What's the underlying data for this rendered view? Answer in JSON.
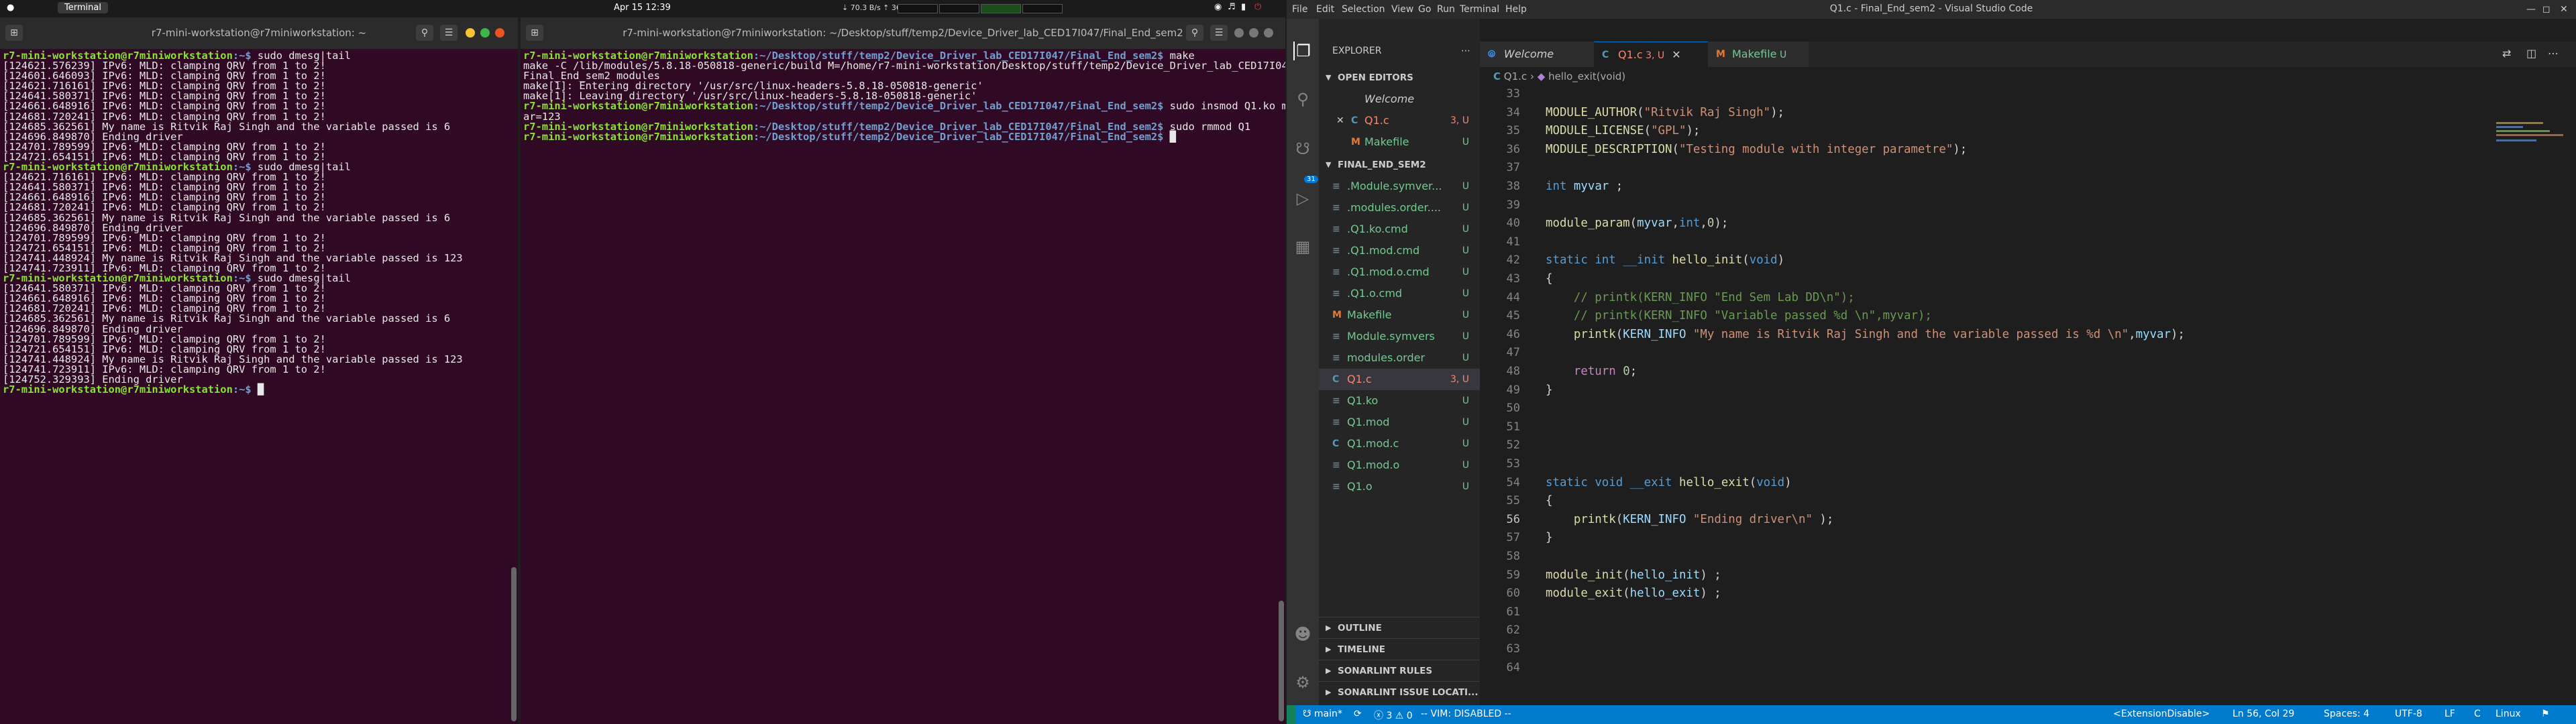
{
  "topbar": {
    "activities": "●",
    "app_name": "Terminal",
    "date": "Apr 15  12:39",
    "net": "⇣ 70.3 B/s ⇡ 368 B/s",
    "tray_icons": [
      "wifi-icon",
      "volume-icon",
      "battery-icon",
      "power-icon"
    ]
  },
  "term1": {
    "title": "r7-mini-workstation@r7miniworkstation: ~",
    "lines": [
      {
        "t": "prompt",
        "cmd": "sudo dmesg|tail"
      },
      {
        "t": "out",
        "text": "[124621.576239] IPv6: MLD: clamping QRV from 1 to 2!"
      },
      {
        "t": "out",
        "text": "[124601.646093] IPv6: MLD: clamping QRV from 1 to 2!"
      },
      {
        "t": "out",
        "text": "[124621.716161] IPv6: MLD: clamping QRV from 1 to 2!"
      },
      {
        "t": "out",
        "text": "[124641.580371] IPv6: MLD: clamping QRV from 1 to 2!"
      },
      {
        "t": "out",
        "text": "[124661.648916] IPv6: MLD: clamping QRV from 1 to 2!"
      },
      {
        "t": "out",
        "text": "[124681.720241] IPv6: MLD: clamping QRV from 1 to 2!"
      },
      {
        "t": "out",
        "text": "[124685.362561] My name is Ritvik Raj Singh and the variable passed is 6"
      },
      {
        "t": "out",
        "text": "[124696.849870] Ending driver"
      },
      {
        "t": "out",
        "text": "[124701.789599] IPv6: MLD: clamping QRV from 1 to 2!"
      },
      {
        "t": "out",
        "text": "[124721.654151] IPv6: MLD: clamping QRV from 1 to 2!"
      },
      {
        "t": "prompt",
        "cmd": "sudo dmesg|tail"
      },
      {
        "t": "out",
        "text": "[124621.716161] IPv6: MLD: clamping QRV from 1 to 2!"
      },
      {
        "t": "out",
        "text": "[124641.580371] IPv6: MLD: clamping QRV from 1 to 2!"
      },
      {
        "t": "out",
        "text": "[124661.648916] IPv6: MLD: clamping QRV from 1 to 2!"
      },
      {
        "t": "out",
        "text": "[124681.720241] IPv6: MLD: clamping QRV from 1 to 2!"
      },
      {
        "t": "out",
        "text": "[124685.362561] My name is Ritvik Raj Singh and the variable passed is 6"
      },
      {
        "t": "out",
        "text": "[124696.849870] Ending driver"
      },
      {
        "t": "out",
        "text": "[124701.789599] IPv6: MLD: clamping QRV from 1 to 2!"
      },
      {
        "t": "out",
        "text": "[124721.654151] IPv6: MLD: clamping QRV from 1 to 2!"
      },
      {
        "t": "out",
        "text": "[124741.448924] My name is Ritvik Raj Singh and the variable passed is 123"
      },
      {
        "t": "out",
        "text": "[124741.723911] IPv6: MLD: clamping QRV from 1 to 2!"
      },
      {
        "t": "prompt",
        "cmd": "sudo dmesg|tail"
      },
      {
        "t": "out",
        "text": "[124641.580371] IPv6: MLD: clamping QRV from 1 to 2!"
      },
      {
        "t": "out",
        "text": "[124661.648916] IPv6: MLD: clamping QRV from 1 to 2!"
      },
      {
        "t": "out",
        "text": "[124681.720241] IPv6: MLD: clamping QRV from 1 to 2!"
      },
      {
        "t": "out",
        "text": "[124685.362561] My name is Ritvik Raj Singh and the variable passed is 6"
      },
      {
        "t": "out",
        "text": "[124696.849870] Ending driver"
      },
      {
        "t": "out",
        "text": "[124701.789599] IPv6: MLD: clamping QRV from 1 to 2!"
      },
      {
        "t": "out",
        "text": "[124721.654151] IPv6: MLD: clamping QRV from 1 to 2!"
      },
      {
        "t": "out",
        "text": "[124741.448924] My name is Ritvik Raj Singh and the variable passed is 123"
      },
      {
        "t": "out",
        "text": "[124741.723911] IPv6: MLD: clamping QRV from 1 to 2!"
      },
      {
        "t": "out",
        "text": "[124752.329393] Ending driver"
      },
      {
        "t": "prompt",
        "cmd": "█"
      }
    ],
    "prompt_user": "r7-mini-workstation@r7miniworkstation",
    "prompt_path": ":~$ "
  },
  "term2": {
    "title": "r7-mini-workstation@r7miniworkstation: ~/Desktop/stuff/temp2/Device_Driver_lab_CED17I047/Final_End_sem2",
    "prompt_user": "r7-mini-workstation@r7miniworkstation",
    "prompt_path": ":~/Desktop/stuff/temp2/Device_Driver_lab_CED17I047/Final_End_sem2$ ",
    "lines": [
      {
        "t": "prompt",
        "cmd": "make"
      },
      {
        "t": "out",
        "text": "make -C /lib/modules/5.8.18-050818-generic/build M=/home/r7-mini-workstation/Desktop/stuff/temp2/Device_Driver_lab_CED17I047/"
      },
      {
        "t": "out",
        "text": "Final_End_sem2 modules"
      },
      {
        "t": "out",
        "text": "make[1]: Entering directory '/usr/src/linux-headers-5.8.18-050818-generic'"
      },
      {
        "t": "out",
        "text": "make[1]: Leaving directory '/usr/src/linux-headers-5.8.18-050818-generic'"
      },
      {
        "t": "prompt",
        "cmd": "sudo insmod Q1.ko myv"
      },
      {
        "t": "out",
        "text": "ar=123"
      },
      {
        "t": "prompt",
        "cmd": "sudo rmmod Q1"
      },
      {
        "t": "prompt",
        "cmd": "█"
      }
    ]
  },
  "vscode": {
    "menu": [
      "File",
      "Edit",
      "Selection",
      "View",
      "Go",
      "Run",
      "Terminal",
      "Help"
    ],
    "window_title": "Q1.c - Final_End_sem2 - Visual Studio Code",
    "scm_badge": "31",
    "explorer_title": "EXPLORER",
    "open_editors_title": "OPEN EDITORS",
    "open_editors": [
      {
        "icon": "",
        "name": "Welcome",
        "status": "",
        "color": "#cccccc",
        "italic": true
      },
      {
        "icon": "C",
        "name": "Q1.c",
        "status": "3, U",
        "color": "#f48771",
        "close": "✕"
      },
      {
        "icon": "M",
        "name": "Makefile",
        "status": "U",
        "color": "#73c991"
      }
    ],
    "folder_title": "FINAL_END_SEM2",
    "files": [
      {
        "icon": "≡",
        "name": ".Module.symver...",
        "status": "U",
        "color": "#73c991"
      },
      {
        "icon": "≡",
        "name": ".modules.order....",
        "status": "U",
        "color": "#73c991"
      },
      {
        "icon": "≡",
        "name": ".Q1.ko.cmd",
        "status": "U",
        "color": "#73c991"
      },
      {
        "icon": "≡",
        "name": ".Q1.mod.cmd",
        "status": "U",
        "color": "#73c991"
      },
      {
        "icon": "≡",
        "name": ".Q1.mod.o.cmd",
        "status": "U",
        "color": "#73c991"
      },
      {
        "icon": "≡",
        "name": ".Q1.o.cmd",
        "status": "U",
        "color": "#73c991"
      },
      {
        "icon": "M",
        "name": "Makefile",
        "status": "U",
        "color": "#73c991"
      },
      {
        "icon": "≡",
        "name": "Module.symvers",
        "status": "U",
        "color": "#73c991"
      },
      {
        "icon": "≡",
        "name": "modules.order",
        "status": "U",
        "color": "#73c991"
      },
      {
        "icon": "C",
        "name": "Q1.c",
        "status": "3, U",
        "color": "#f48771",
        "sel": true
      },
      {
        "icon": "≡",
        "name": "Q1.ko",
        "status": "U",
        "color": "#73c991"
      },
      {
        "icon": "≡",
        "name": "Q1.mod",
        "status": "U",
        "color": "#73c991"
      },
      {
        "icon": "C",
        "name": "Q1.mod.c",
        "status": "U",
        "color": "#73c991"
      },
      {
        "icon": "≡",
        "name": "Q1.mod.o",
        "status": "U",
        "color": "#73c991"
      },
      {
        "icon": "≡",
        "name": "Q1.o",
        "status": "U",
        "color": "#73c991"
      }
    ],
    "bottom_sections": [
      "OUTLINE",
      "TIMELINE",
      "SONARLINT RULES",
      "SONARLINT ISSUE LOCATI..."
    ],
    "tabs": [
      {
        "icon": "⦾",
        "name": "Welcome",
        "status": "",
        "color": "#cccccc",
        "italic": true
      },
      {
        "icon": "C",
        "name": "Q1.c",
        "status": "3, U",
        "color": "#f48771",
        "active": true,
        "close": "✕"
      },
      {
        "icon": "M",
        "name": "Makefile",
        "status": "U",
        "color": "#73c991"
      }
    ],
    "breadcrumb": [
      "Q1.c",
      "hello_exit(void)"
    ],
    "code_lines": [
      {
        "n": "33",
        "tokens": []
      },
      {
        "n": "34",
        "tokens": [
          [
            "f",
            "MODULE_AUTHOR"
          ],
          [
            "p",
            "("
          ],
          [
            "s",
            "\"Ritvik Raj Singh\""
          ],
          [
            "p",
            ");"
          ]
        ]
      },
      {
        "n": "35",
        "tokens": [
          [
            "f",
            "MODULE_LICENSE"
          ],
          [
            "p",
            "("
          ],
          [
            "s",
            "\"GPL\""
          ],
          [
            "p",
            ");"
          ]
        ]
      },
      {
        "n": "36",
        "tokens": [
          [
            "f",
            "MODULE_DESCRIPTION"
          ],
          [
            "p",
            "("
          ],
          [
            "s",
            "\"Testing module with integer parametre\""
          ],
          [
            "p",
            ");"
          ]
        ]
      },
      {
        "n": "37",
        "tokens": []
      },
      {
        "n": "38",
        "tokens": [
          [
            "k",
            "int"
          ],
          [
            "p",
            " "
          ],
          [
            "v",
            "myvar"
          ],
          [
            "p",
            " ;"
          ]
        ]
      },
      {
        "n": "39",
        "tokens": []
      },
      {
        "n": "40",
        "tokens": [
          [
            "f",
            "module_param"
          ],
          [
            "p",
            "("
          ],
          [
            "v",
            "myvar"
          ],
          [
            "p",
            ","
          ],
          [
            "k",
            "int"
          ],
          [
            "p",
            ","
          ],
          [
            "n",
            "0"
          ],
          [
            "p",
            ");"
          ]
        ]
      },
      {
        "n": "41",
        "tokens": []
      },
      {
        "n": "42",
        "tokens": [
          [
            "k",
            "static"
          ],
          [
            "p",
            " "
          ],
          [
            "k",
            "int"
          ],
          [
            "p",
            " "
          ],
          [
            "k",
            "__init"
          ],
          [
            "p",
            " "
          ],
          [
            "f",
            "hello_init"
          ],
          [
            "p",
            "("
          ],
          [
            "k",
            "void"
          ],
          [
            "p",
            ")"
          ]
        ]
      },
      {
        "n": "43",
        "tokens": [
          [
            "p",
            "{"
          ]
        ]
      },
      {
        "n": "44",
        "tokens": [
          [
            "p",
            "    "
          ],
          [
            "c",
            "// printk(KERN_INFO \"End Sem Lab DD\\n\");"
          ]
        ]
      },
      {
        "n": "45",
        "tokens": [
          [
            "p",
            "    "
          ],
          [
            "c",
            "// printk(KERN_INFO \"Variable passed %d \\n\",myvar);"
          ]
        ]
      },
      {
        "n": "46",
        "tokens": [
          [
            "p",
            "    "
          ],
          [
            "f",
            "printk"
          ],
          [
            "p",
            "("
          ],
          [
            "v",
            "KERN_INFO"
          ],
          [
            "p",
            " "
          ],
          [
            "s",
            "\"My name is Ritvik Raj Singh and the variable passed is %d \\n\""
          ],
          [
            "p",
            ","
          ],
          [
            "v",
            "myvar"
          ],
          [
            "p",
            ");"
          ]
        ]
      },
      {
        "n": "47",
        "tokens": []
      },
      {
        "n": "48",
        "tokens": [
          [
            "p",
            "    "
          ],
          [
            "m",
            "return"
          ],
          [
            "p",
            " "
          ],
          [
            "n",
            "0"
          ],
          [
            "p",
            ";"
          ]
        ]
      },
      {
        "n": "49",
        "tokens": [
          [
            "p",
            "}"
          ]
        ]
      },
      {
        "n": "50",
        "tokens": []
      },
      {
        "n": "51",
        "tokens": []
      },
      {
        "n": "52",
        "tokens": []
      },
      {
        "n": "53",
        "tokens": []
      },
      {
        "n": "54",
        "tokens": [
          [
            "k",
            "static"
          ],
          [
            "p",
            " "
          ],
          [
            "k",
            "void"
          ],
          [
            "p",
            " "
          ],
          [
            "k",
            "__exit"
          ],
          [
            "p",
            " "
          ],
          [
            "f",
            "hello_exit"
          ],
          [
            "p",
            "("
          ],
          [
            "k",
            "void"
          ],
          [
            "p",
            ")"
          ]
        ]
      },
      {
        "n": "55",
        "tokens": [
          [
            "p",
            "{"
          ]
        ]
      },
      {
        "n": "56",
        "tokens": [
          [
            "p",
            "    "
          ],
          [
            "f",
            "printk"
          ],
          [
            "p",
            "("
          ],
          [
            "v",
            "KERN_INFO"
          ],
          [
            "p",
            " "
          ],
          [
            "s",
            "\"Ending driver\\n\""
          ],
          [
            "p",
            " );"
          ]
        ]
      },
      {
        "n": "57",
        "tokens": [
          [
            "p",
            "}"
          ]
        ]
      },
      {
        "n": "58",
        "tokens": []
      },
      {
        "n": "59",
        "tokens": [
          [
            "f",
            "module_init"
          ],
          [
            "p",
            "("
          ],
          [
            "v",
            "hello_init"
          ],
          [
            "p",
            ") ;"
          ]
        ]
      },
      {
        "n": "60",
        "tokens": [
          [
            "f",
            "module_exit"
          ],
          [
            "p",
            "("
          ],
          [
            "v",
            "hello_exit"
          ],
          [
            "p",
            ") ;"
          ]
        ]
      },
      {
        "n": "61",
        "tokens": []
      },
      {
        "n": "62",
        "tokens": []
      },
      {
        "n": "63",
        "tokens": []
      },
      {
        "n": "64",
        "tokens": []
      }
    ],
    "status": {
      "branch": "main*",
      "sync": "⟳",
      "problems": "ⓧ 3 ⚠ 0",
      "vim": "-- VIM: DISABLED --",
      "ext": "<ExtensionDisable>",
      "position": "Ln 56, Col 29",
      "spaces": "Spaces: 4",
      "encoding": "UTF-8",
      "eol": "LF",
      "lang": "C",
      "os": "Linux",
      "bell": "⚑"
    }
  }
}
